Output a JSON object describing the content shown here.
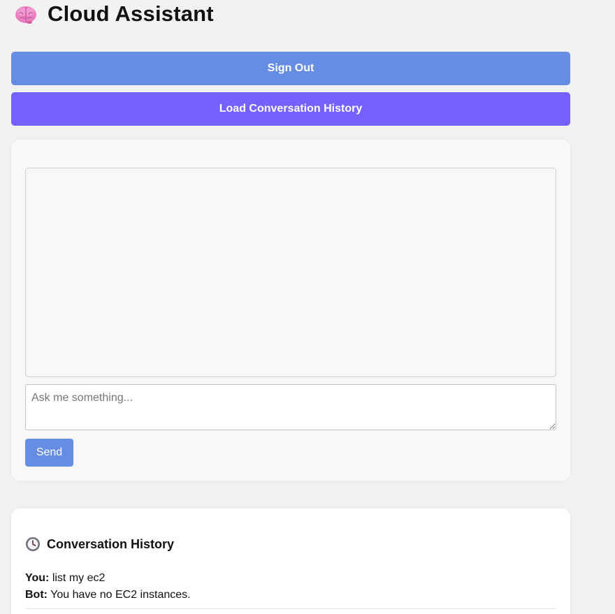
{
  "header": {
    "icon": "brain-icon",
    "title": "Cloud Assistant"
  },
  "buttons": {
    "sign_out": "Sign Out",
    "load_history": "Load Conversation History"
  },
  "chat": {
    "input_placeholder": "Ask me something...",
    "input_value": "",
    "send_label": "Send"
  },
  "history": {
    "icon": "clock-icon",
    "title": "Conversation History",
    "entries": [
      {
        "user_label": "You:",
        "user_text": "list my ec2",
        "bot_label": "Bot:",
        "bot_text": "You have no EC2 instances."
      }
    ]
  },
  "colors": {
    "page_bg": "#f2f2f2",
    "sign_out_bg": "#658de3",
    "load_history_bg": "#7461ff",
    "send_bg": "#658de3"
  }
}
